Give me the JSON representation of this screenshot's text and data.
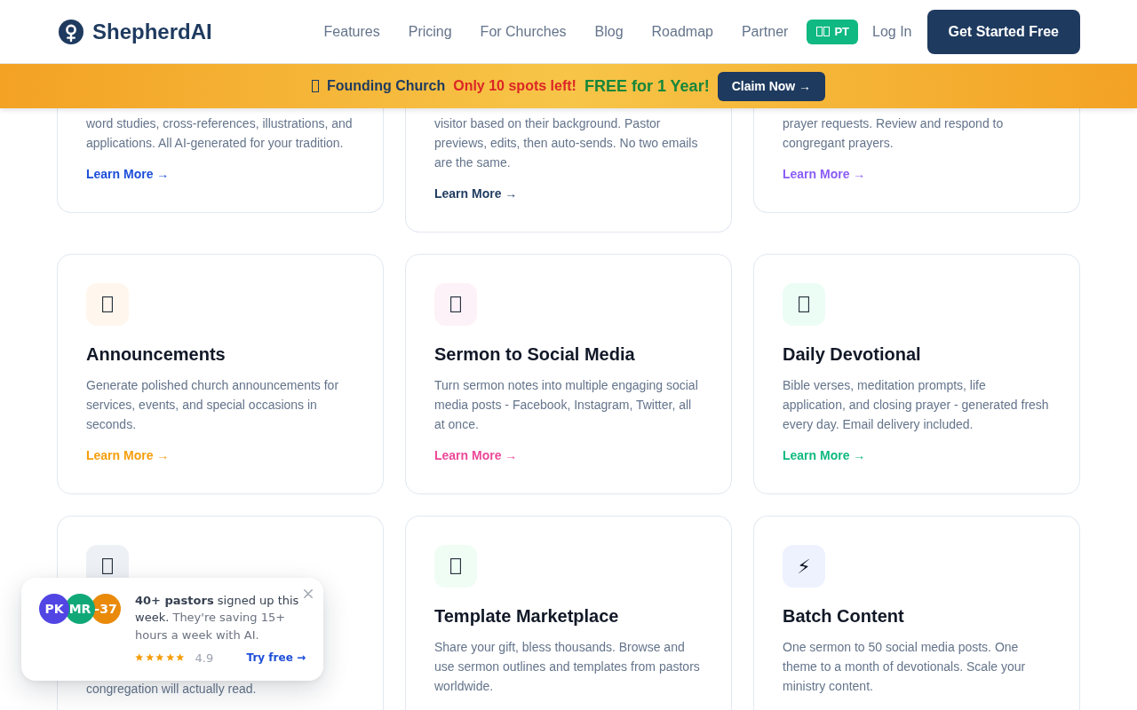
{
  "header": {
    "logo": "ShepherdAI",
    "nav": [
      "Features",
      "Pricing",
      "For Churches",
      "Blog",
      "Roadmap",
      "Partner"
    ],
    "language": "PT",
    "login": "Log In",
    "cta": "Get Started Free"
  },
  "banner": {
    "title": "Founding Church",
    "urgency": "Only 10 spots left!",
    "offer": "FREE for 1 Year!",
    "button": "Claim Now →"
  },
  "cards": [
    {
      "description": "word studies, cross-references, illustrations, and applications. All AI-generated for your tradition.",
      "link": {
        "label": "Learn More →",
        "color": "#1d4ed8"
      }
    },
    {
      "description": "visitor based on their background. Pastor previews, edits, then auto-sends. No two emails are the same.",
      "link": {
        "label": "Learn More →",
        "color": "#1e3a5f"
      }
    },
    {
      "description": "prayer requests. Review and respond to congregant prayers.",
      "link": {
        "label": "Learn More →",
        "color": "#8b5cf6"
      }
    },
    {
      "icon": {
        "color": "#fff7ed"
      },
      "title": "Announcements",
      "description": "Generate polished church announcements for services, events, and special occasions in seconds.",
      "link": {
        "label": "Learn More →",
        "color": "#f59e0b"
      }
    },
    {
      "icon": {
        "color": "#fdf2f8"
      },
      "title": "Sermon to Social Media",
      "description": "Turn sermon notes into multiple engaging social media posts - Facebook, Instagram, Twitter, all at once.",
      "link": {
        "label": "Learn More →",
        "color": "#ec4899"
      }
    },
    {
      "icon": {
        "color": "#ecfdf5"
      },
      "title": "Daily Devotional",
      "description": "Bible verses, meditation prompts, life application, and closing prayer - generated fresh every day. Email delivery included.",
      "link": {
        "label": "Learn More →",
        "color": "#10b981"
      }
    },
    {
      "icon": {
        "color": "#edf1f5"
      },
      "description": "congregation will actually read."
    },
    {
      "icon": {
        "color": "#f0fdf4"
      },
      "title": "Template Marketplace",
      "description": "Share your gift, bless thousands. Browse and use sermon outlines and templates from pastors worldwide."
    },
    {
      "icon": {
        "color": "#eef2ff",
        "glyph": "⚡"
      },
      "title": "Batch Content",
      "description": "One sermon to 50 social media posts. One theme to a month of devotionals. Scale your ministry content."
    }
  ],
  "toast": {
    "avatars": [
      {
        "initials": "PK",
        "color": "#5145e4"
      },
      {
        "initials": "MR",
        "color": "#11a877"
      },
      {
        "initials": "-37",
        "color": "#e98a0b"
      }
    ],
    "headline": "**40+ pastors** signed up this week.",
    "detail": "They're saving 15+ hours a week with AI.",
    "rating": {
      "stars": 5,
      "value": "4.9"
    },
    "link": "Try free →"
  }
}
